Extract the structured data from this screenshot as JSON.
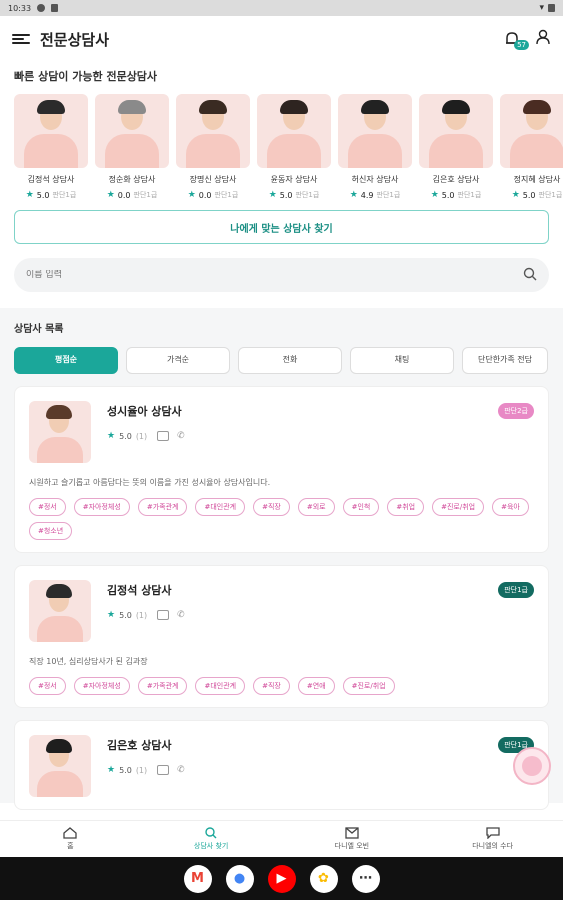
{
  "status": {
    "time": "10:33"
  },
  "header": {
    "title": "전문상담사",
    "notification_count": "57"
  },
  "quick": {
    "title": "빠른 상담이 가능한 전문상담사",
    "counselors": [
      {
        "name": "김정석 상담사",
        "rating": "5.0",
        "grade": "판단1급",
        "hair": "#2b2b2b"
      },
      {
        "name": "정순화 상담사",
        "rating": "0.0",
        "grade": "판단1급",
        "hair": "#8a8a8a"
      },
      {
        "name": "장명신 상담사",
        "rating": "0.0",
        "grade": "판단1급",
        "hair": "#3a2b22"
      },
      {
        "name": "윤동자 상담사",
        "rating": "5.0",
        "grade": "판단1급",
        "hair": "#2e2420"
      },
      {
        "name": "허신자 상담사",
        "rating": "4.9",
        "grade": "판단1급",
        "hair": "#222222"
      },
      {
        "name": "김은호 상담사",
        "rating": "5.0",
        "grade": "판단1급",
        "hair": "#1e1e1e"
      },
      {
        "name": "정지혜 상담사",
        "rating": "5.0",
        "grade": "판단1급",
        "hair": "#4a2c22"
      }
    ],
    "find_button": "나에게 맞는 상담사 찾기"
  },
  "search": {
    "placeholder": "이름 입력"
  },
  "list": {
    "title": "상담사 목록",
    "sort_tabs": [
      "평점순",
      "가격순",
      "전화",
      "채팅",
      "단단한가족 전담"
    ],
    "cards": [
      {
        "name": "성시율아 상담사",
        "rating": "5.0",
        "count": "(1)",
        "badge": "판단2급",
        "badge_color": "#e889c5",
        "hair": "#5a3a2a",
        "desc": "시원하고 슬기롭고 아름답다는 뜻의 이름을 가진 성시율아 상담사입니다.",
        "tags": [
          "#정서",
          "#자아정체성",
          "#가족관계",
          "#대인관계",
          "#직장",
          "#외로",
          "#인척",
          "#취업",
          "#진로/취업",
          "#육아",
          "#청소년"
        ]
      },
      {
        "name": "김정석 상담사",
        "rating": "5.0",
        "count": "(1)",
        "badge": "판단1급",
        "badge_color": "#136b61",
        "hair": "#2b2b2b",
        "desc": "직장 10년, 심리상담사가 된 김과장",
        "tags": [
          "#정서",
          "#자아정체성",
          "#가족관계",
          "#대인관계",
          "#직장",
          "#연애",
          "#진로/취업"
        ]
      },
      {
        "name": "김은호 상담사",
        "rating": "5.0",
        "count": "(1)",
        "badge": "판단1급",
        "badge_color": "#136b61",
        "hair": "#1e1e1e",
        "desc": "",
        "tags": []
      }
    ]
  },
  "bottom_nav": [
    "홈",
    "상담사 찾기",
    "다니엘 오빈",
    "다니엘의 수다"
  ],
  "dock": [
    {
      "icon": "gmail-icon",
      "label": "M",
      "color": "#ea4335",
      "bg": "#ffffff"
    },
    {
      "icon": "chrome-icon",
      "label": "●",
      "color": "#4285f4",
      "bg": "#ffffff"
    },
    {
      "icon": "youtube-icon",
      "label": "▶",
      "color": "#ffffff",
      "bg": "#ff0000"
    },
    {
      "icon": "photos-icon",
      "label": "✿",
      "color": "#fbbc04",
      "bg": "#ffffff"
    },
    {
      "icon": "apps-icon",
      "label": "⋯",
      "color": "#333333",
      "bg": "#ffffff"
    }
  ]
}
